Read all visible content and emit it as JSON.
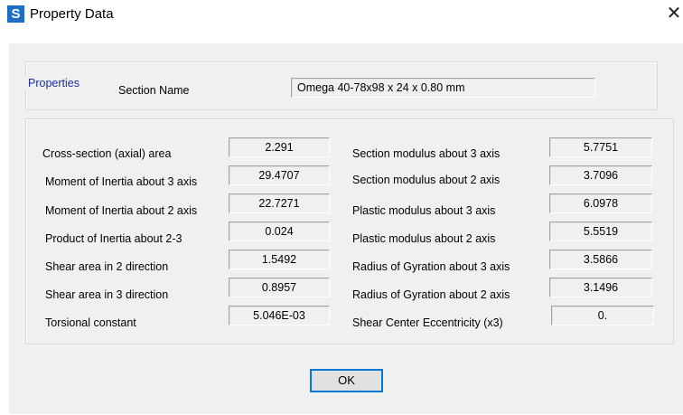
{
  "window": {
    "title": "Property Data",
    "app_icon_letter": "S"
  },
  "section": {
    "label": "Section Name",
    "value": "Omega 40-78x98 x 24 x 0.80 mm"
  },
  "properties": {
    "legend": "Properties",
    "left": [
      {
        "label": "Cross-section (axial) area",
        "value": "2.291"
      },
      {
        "label": "Moment of Inertia about 3 axis",
        "value": "29.4707"
      },
      {
        "label": "Moment of Inertia about 2 axis",
        "value": "22.7271"
      },
      {
        "label": "Product of Inertia about 2-3",
        "value": "0.024"
      },
      {
        "label": "Shear area in 2 direction",
        "value": "1.5492"
      },
      {
        "label": "Shear area in 3 direction",
        "value": "0.8957"
      },
      {
        "label": "Torsional constant",
        "value": "5.046E-03"
      }
    ],
    "right": [
      {
        "label": "Section modulus about 3 axis",
        "value": "5.7751"
      },
      {
        "label": "Section modulus about 2 axis",
        "value": "3.7096"
      },
      {
        "label": "Plastic modulus about 3 axis",
        "value": "6.0978"
      },
      {
        "label": "Plastic modulus about 2 axis",
        "value": "5.5519"
      },
      {
        "label": "Radius of Gyration about 3 axis",
        "value": "3.5866"
      },
      {
        "label": "Radius of Gyration about 2 axis",
        "value": "3.1496"
      },
      {
        "label": "Shear Center Eccentricity (x3)",
        "value": "0."
      }
    ]
  },
  "buttons": {
    "ok": "OK"
  },
  "icons": {
    "close": "close-icon",
    "app": "sap-app-icon"
  },
  "colors": {
    "accent": "#0078d7",
    "legend": "#1a2fa8",
    "app_icon": "#1c6fc4"
  }
}
